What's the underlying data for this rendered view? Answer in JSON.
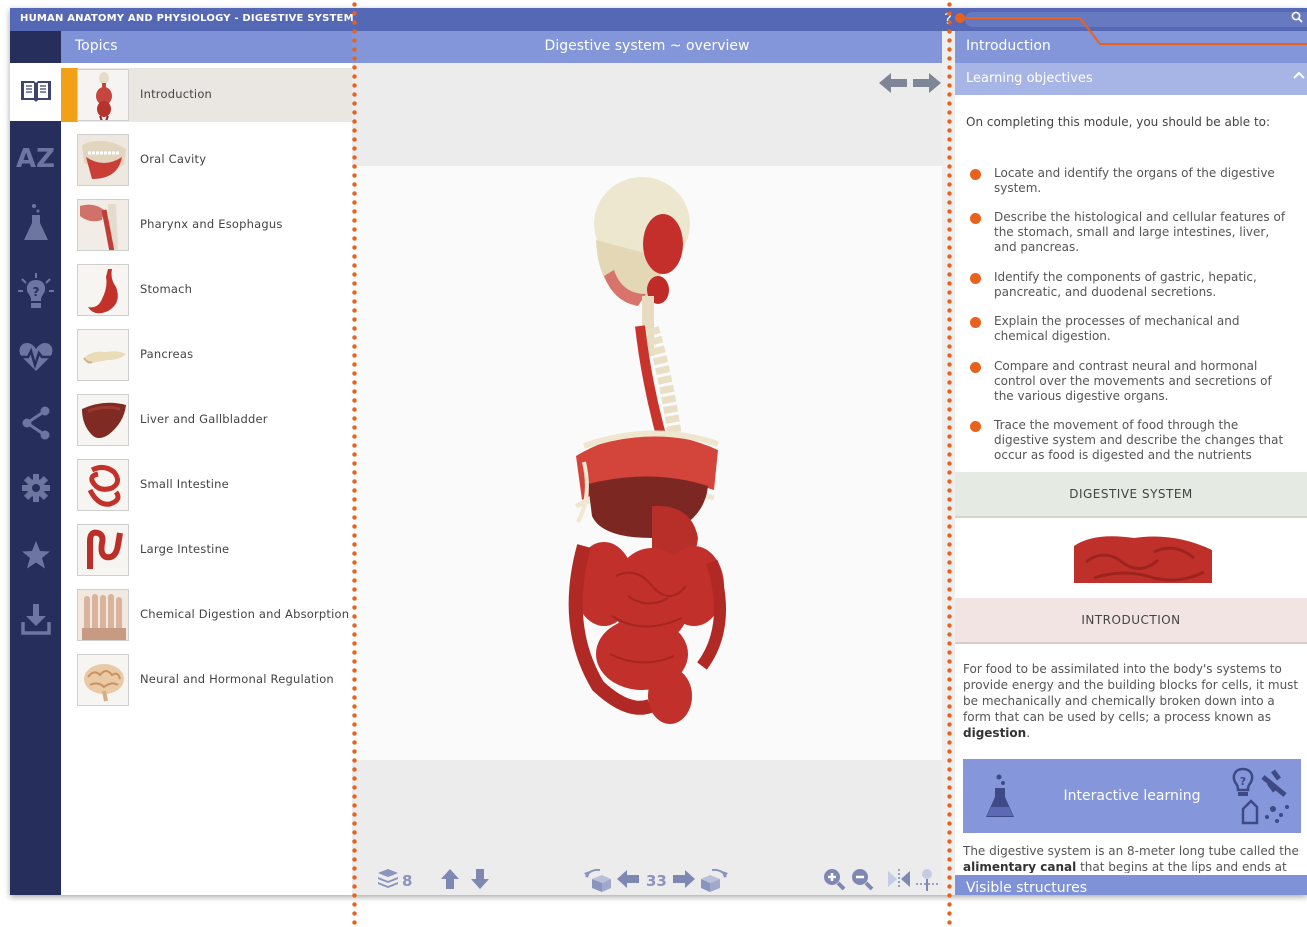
{
  "app": {
    "title": "HUMAN ANATOMY AND PHYSIOLOGY - DIGESTIVE SYSTEM",
    "help_label": "?"
  },
  "sidebar": {
    "icons": [
      "book-icon",
      "az-icon",
      "flask-icon",
      "lightbulb-icon",
      "heartbeat-icon",
      "share-icon",
      "gear-icon",
      "star-icon",
      "download-icon"
    ],
    "az_label": "AZ"
  },
  "topics": {
    "header": "Topics",
    "active_index": 0,
    "items": [
      {
        "label": "Introduction"
      },
      {
        "label": "Oral Cavity"
      },
      {
        "label": "Pharynx and Esophagus"
      },
      {
        "label": "Stomach"
      },
      {
        "label": "Pancreas"
      },
      {
        "label": "Liver and Gallbladder"
      },
      {
        "label": "Small Intestine"
      },
      {
        "label": "Large Intestine"
      },
      {
        "label": "Chemical Digestion and Absorption"
      },
      {
        "label": "Neural and Hormonal Regulation"
      }
    ]
  },
  "viewer": {
    "title": "Digestive system ~ overview",
    "layers_count": "8",
    "frame_number": "33"
  },
  "panel": {
    "header": "Introduction",
    "subheader": "Learning objectives",
    "intro": "On completing this module, you should be able to:",
    "objectives": [
      "Locate and identify the organs of the digestive system.",
      "Describe the histological and cellular features of the stomach, small and large intestines, liver, and pancreas.",
      "Identify the components of gastric, hepatic, pancreatic, and duodenal secretions.",
      "Explain the processes of mechanical and chemical digestion.",
      "Compare and contrast neural and hormonal control over the movements and secretions of the various digestive organs.",
      "Trace the movement of food through the digestive system and describe the changes that occur as food is digested and the nutrients"
    ],
    "band_digestive": "DIGESTIVE SYSTEM",
    "band_intro": "INTRODUCTION",
    "para1_text": "For food to be assimilated into the body's systems to provide energy and the building blocks for cells, it must be mechanically and chemically broken down into a form that can be used by cells; a process known as",
    "para1_bold": "digestion",
    "para1_end": ".",
    "interactive_label": "Interactive learning",
    "para2_text": "The digestive system is an 8-meter long tube called the",
    "para2_bold": "alimentary canal",
    "para2_end": "that begins at the lips and ends at the",
    "visible_structures": "Visible structures"
  },
  "colors": {
    "accent": "#e8621e",
    "header_blue": "#8396da",
    "sidebar_dark": "#262f5c",
    "active_marker": "#f2a015"
  }
}
